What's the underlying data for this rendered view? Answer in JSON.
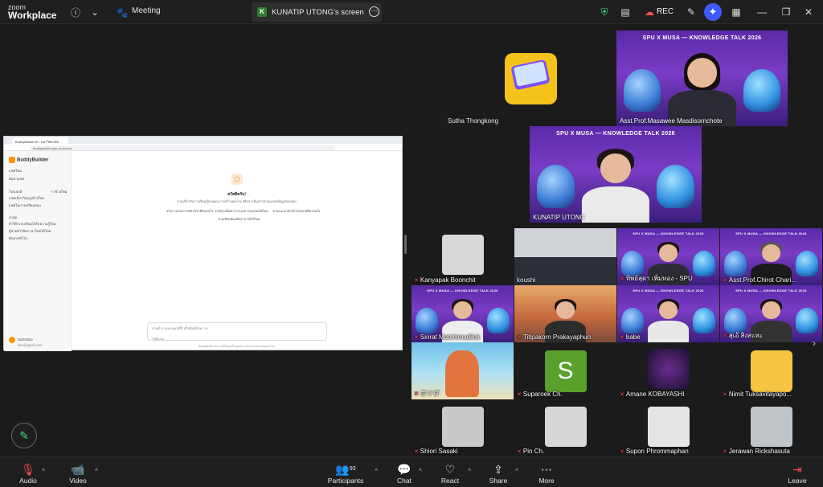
{
  "topbar": {
    "logo_line1": "zoom",
    "logo_line2": "Workplace",
    "meeting_label": "Meeting",
    "share_tab_initial": "K",
    "share_tab_label": "KUNATIP UTONG's screen",
    "rec_label": "REC"
  },
  "shared_screen": {
    "browser_tab": "BuddyBuilder AI - มหาวิทยาลัยศรีปทุม",
    "url": "buddybuilder.spu.ac.th/chat",
    "brand": "BuddyBuilder",
    "sidebar_items": [
      "แชทใหม่",
      "ค้นหาแชท",
      "โปรเจกต์",
      "+ สร้างใหม่",
      "แชทเกี่ยวกับครูสร้างใหม่",
      "แชทในการเตรียมสอน",
      "ล่าสุด",
      "ทำให้ระบบเรียนได้รับความรู้ใหม่",
      "ผู้ช่วยทำวิจัยภาษาไทยได้ไหม",
      "ทักทายทั่วไป"
    ],
    "user_name": "SoGoGoo",
    "user_email": "free@gmail.com",
    "welcome_title": "สวัสดีครับ!",
    "welcome_sub": "ถามเกี่ยวกับการเรียนรู้ของคุณ การสร้างผลงาน หรือการค้นคว้าผ่านแหล่งข้อมูลของคุณ",
    "chips": [
      "ช่วยวางแผนการเรียนวิชาที่ฉันสนใจ",
      "ช่วยสรุปเนื้อหาจากเอกสารของฉันได้ไหม",
      "ช่วยแนะนำหัวข้อโปรเจกต์ที่น่าสนใจ",
      "ช่วยเขียนอีเมลถึงอาจารย์ได้ไหม"
    ],
    "input_placeholder": "ถามคำถามของคุณที่นี่ หรือพิมพ์ข้อความ...",
    "input_hint": "ไฟล์แนบ",
    "footer": "BuddyBuilder AI อาจให้ข้อมูลที่ไม่ถูกต้อง โปรดตรวจสอบข้อมูลสำคัญ"
  },
  "banner_text": "SPU X MUSA — KNOWLEDGE TALK 2026",
  "participants": [
    {
      "name": "Sutha Thongkong"
    },
    {
      "name": "Asst.Prof.Masawee Masdisornchote"
    },
    {
      "name": "KUNATIP UTONG"
    },
    {
      "name": "Kanyapak Boonchit"
    },
    {
      "name": "koushi"
    },
    {
      "name": "ทิพย์สุดา เพิ่มทอง - SPU"
    },
    {
      "name": "Asst.Prof.Chirot Chari..."
    },
    {
      "name": "Sirirat Mutchimadilok"
    },
    {
      "name": "Titipakorn Prakayaphun"
    },
    {
      "name": "babe"
    },
    {
      "name": "สุเอ้ สิงสะหะ"
    },
    {
      "name": "ホソダ"
    },
    {
      "name": "Suparoek Ch."
    },
    {
      "name": "Amane KOBAYASHI"
    },
    {
      "name": "Nimit Tuksavitayapo..."
    },
    {
      "name": "Shiori Sasaki"
    },
    {
      "name": "Pin Ch."
    },
    {
      "name": "Supon Phrommaphan"
    },
    {
      "name": "Jerawan Rickshasuta"
    }
  ],
  "suparoek_initial": "S",
  "bottombar": {
    "audio": "Audio",
    "video": "Video",
    "participants": "Participants",
    "participants_count": "93",
    "chat": "Chat",
    "react": "React",
    "share": "Share",
    "more": "More",
    "leave": "Leave"
  },
  "colors": {
    "accent": "#4caf50",
    "leave": "#e53935",
    "banner": "#6a35b8"
  }
}
